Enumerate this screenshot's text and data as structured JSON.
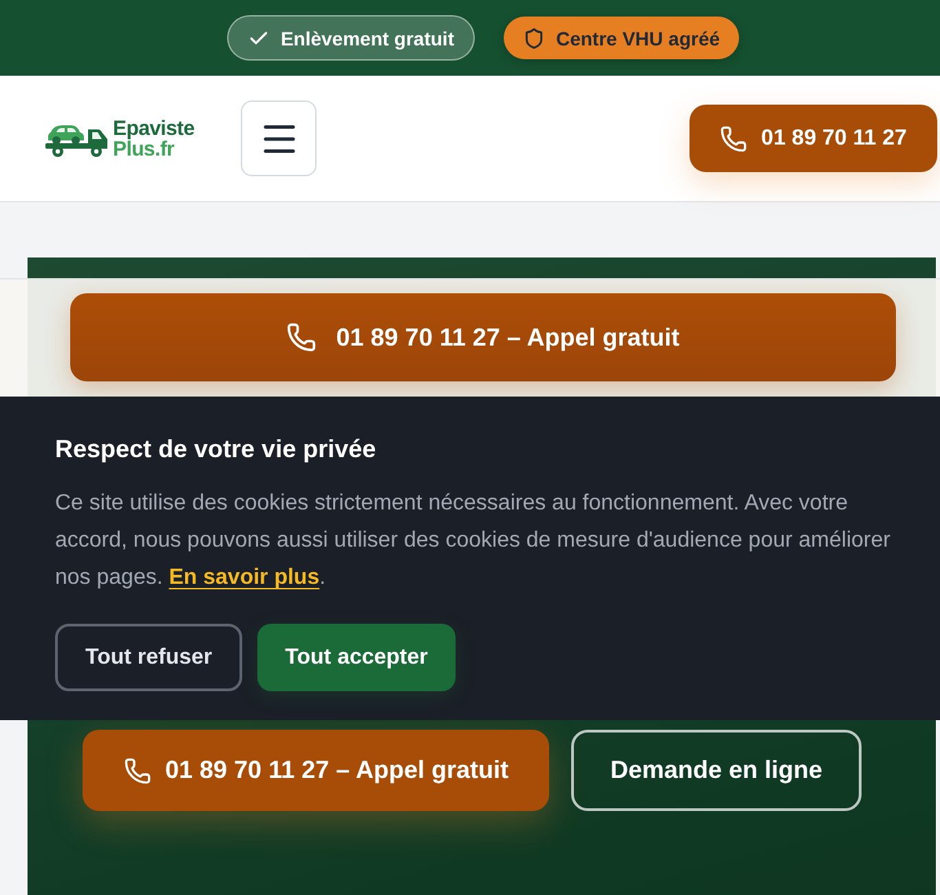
{
  "top_bar": {
    "badges": [
      {
        "kind": "outline",
        "label": "Enlèvement gratuit"
      },
      {
        "kind": "filled",
        "label": "Centre VHU agréé"
      }
    ]
  },
  "header": {
    "logo": {
      "line_1": "Epaviste",
      "line_2": "Plus.fr"
    },
    "call_button": {
      "label": "01 89 70 11 27"
    }
  },
  "sticky_bar": {
    "call_button": {
      "label": "01 89 70 11 27 – Appel gratuit"
    }
  },
  "cookie_banner": {
    "title": "Respect de votre vie privée",
    "text": "Ce site utilise des cookies strictement nécessaires au fonctionnement. Avec votre accord, nous pouvons aussi utiliser des cookies de mesure d'audience pour améliorer nos pages.",
    "link": "En savoir plus",
    "text_after": ".",
    "buttons": [
      {
        "kind": "secondary",
        "label": "Tout refuser"
      },
      {
        "kind": "primary",
        "label": "Tout accepter"
      }
    ]
  },
  "hero": {
    "buttons": [
      {
        "kind": "primary",
        "label": "01 89 70 11 27 – Appel gratuit"
      },
      {
        "kind": "outline",
        "label": "Demande en ligne"
      }
    ]
  }
}
